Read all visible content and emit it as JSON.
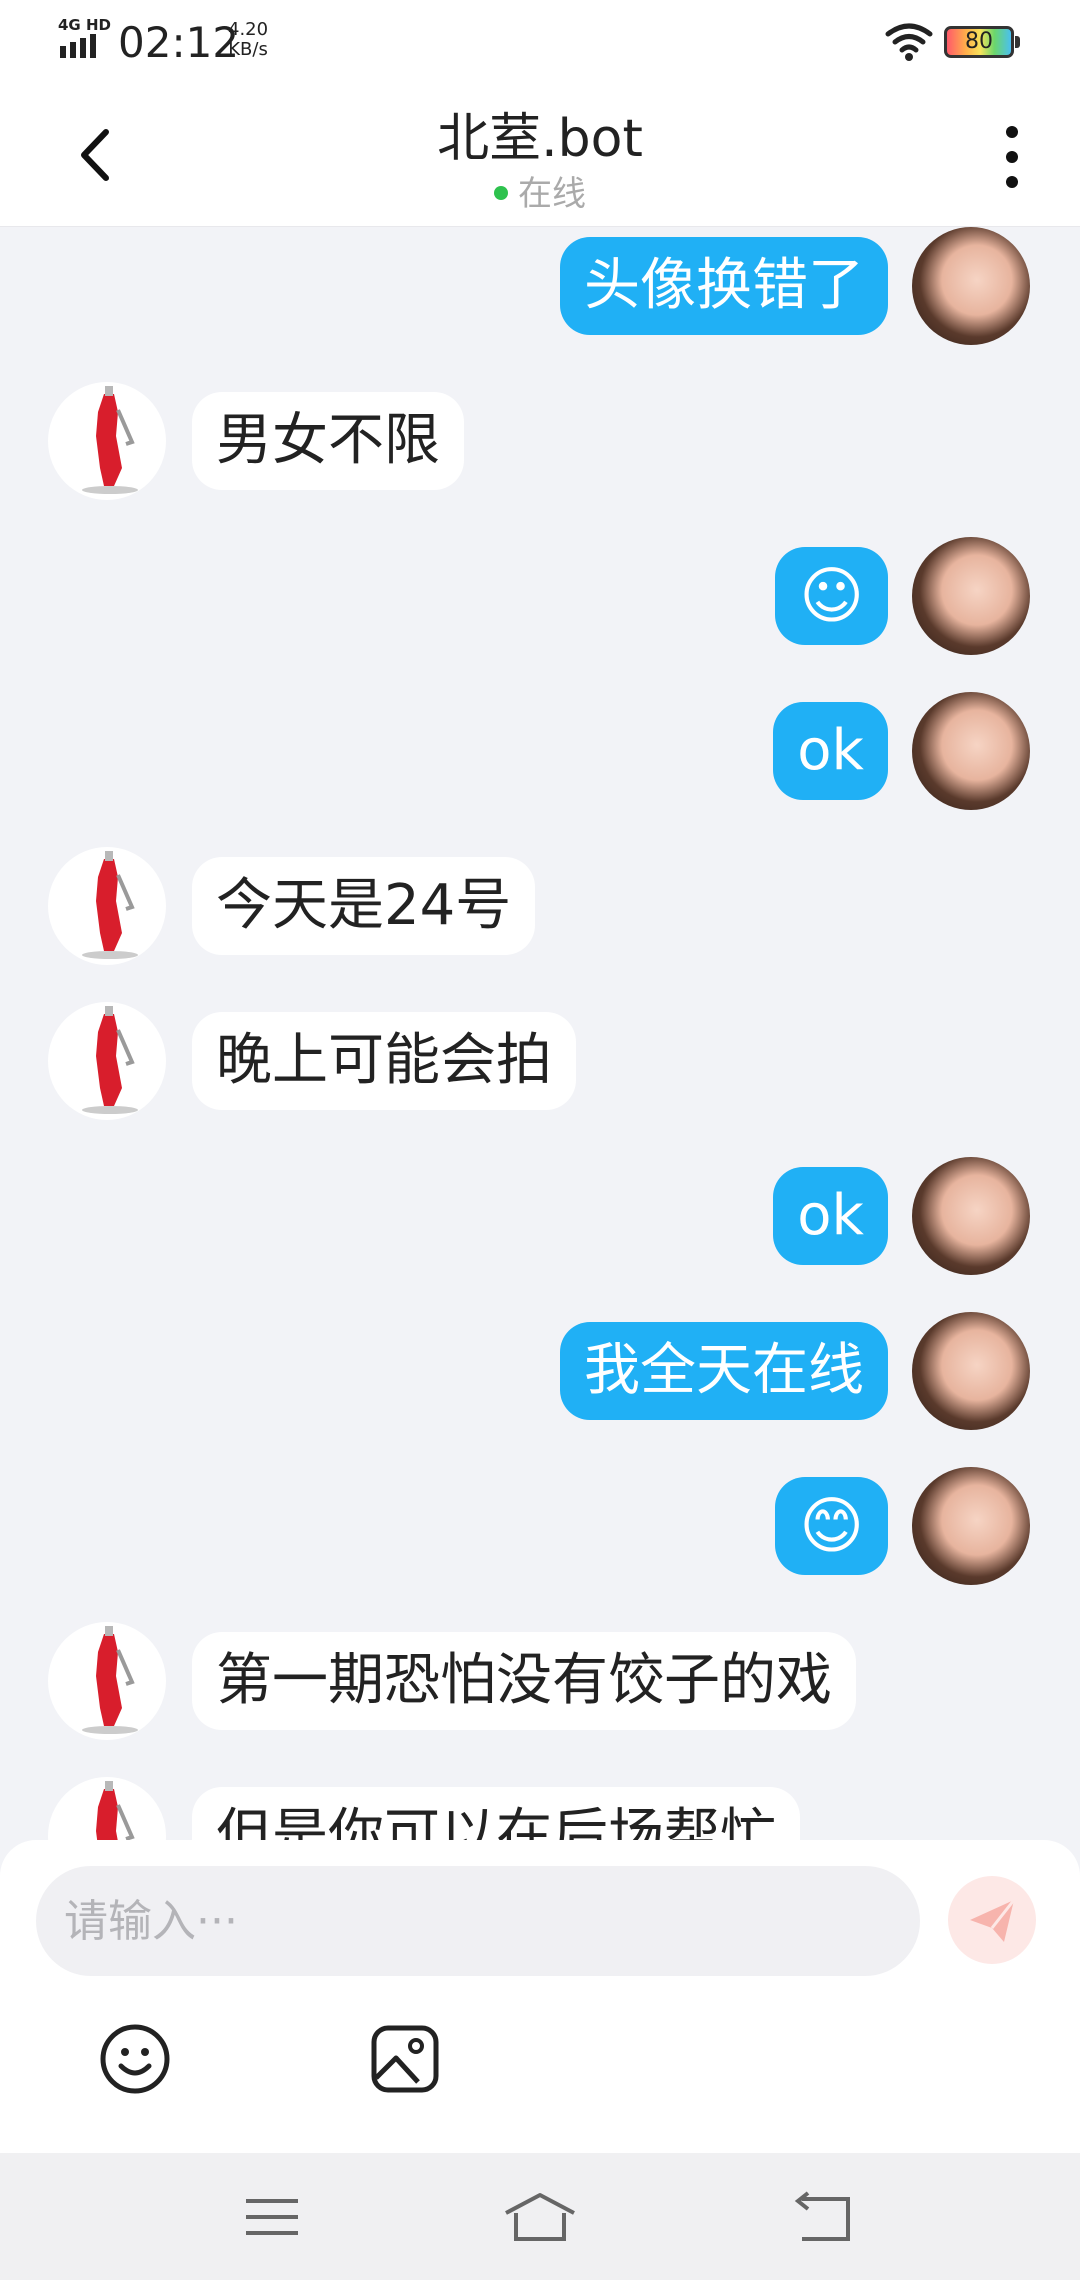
{
  "status_bar": {
    "network": "4G HD",
    "time": "02:12",
    "speed_value": "4.20",
    "speed_unit": "KB/s",
    "battery": "80"
  },
  "header": {
    "title": "北荎.bot",
    "presence": "在线",
    "presence_color": "#2ec24e"
  },
  "messages": [
    {
      "side": "right",
      "text": "头像换错了"
    },
    {
      "side": "left",
      "text": "男女不限"
    },
    {
      "side": "right",
      "text": "☺"
    },
    {
      "side": "right",
      "text": "ok"
    },
    {
      "side": "left",
      "text": "今天是24号"
    },
    {
      "side": "left",
      "text": "晚上可能会拍"
    },
    {
      "side": "right",
      "text": "ok"
    },
    {
      "side": "right",
      "text": "我全天在线"
    },
    {
      "side": "right",
      "text": "😊"
    },
    {
      "side": "left",
      "text": "第一期恐怕没有饺子的戏"
    },
    {
      "side": "left",
      "text": "但是你可以在后场帮忙"
    }
  ],
  "input": {
    "placeholder": "请输入···"
  },
  "colors": {
    "my_bubble": "#20b0f5",
    "other_bubble": "#ffffff",
    "background": "#f2f3f7"
  },
  "icons": {
    "back": "chevron-left-icon",
    "more": "more-vertical-icon",
    "send": "send-icon",
    "emoji": "emoji-icon",
    "image": "image-icon",
    "nav_menu": "menu-icon",
    "nav_home": "home-icon",
    "nav_back": "back-icon"
  }
}
